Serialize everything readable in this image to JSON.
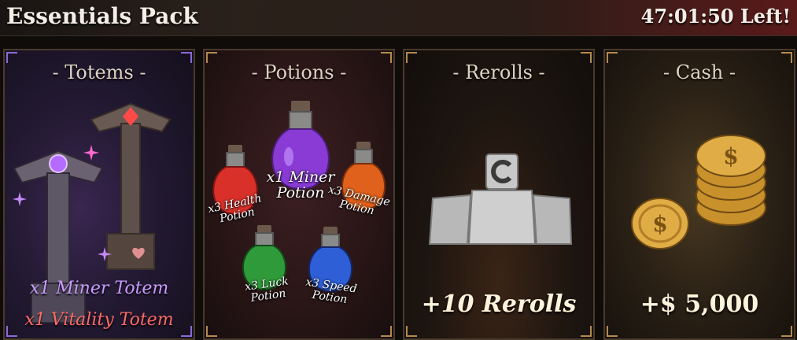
{
  "header": {
    "title": "Essentials Pack",
    "timer": "47:01:50 Left!"
  },
  "panels": {
    "totems": {
      "title": "- Totems -",
      "reward_1": "x1 Miner Totem",
      "reward_2": "x1 Vitality Totem"
    },
    "potions": {
      "title": "- Potions -",
      "items": [
        {
          "qty": "x3 Health",
          "name": "Potion",
          "color": "#d9302a"
        },
        {
          "qty": "x1 Miner",
          "name": "Potion",
          "color": "#8a3bd6"
        },
        {
          "qty": "x3 Damage",
          "name": "Potion",
          "color": "#e0611b"
        },
        {
          "qty": "x3 Luck",
          "name": "Potion",
          "color": "#2f9a3a"
        },
        {
          "qty": "x3 Speed",
          "name": "Potion",
          "color": "#2f5fd6"
        }
      ]
    },
    "rerolls": {
      "title": "- Rerolls -",
      "reward": "+10 Rerolls"
    },
    "cash": {
      "title": "- Cash -",
      "reward": "+$ 5,000"
    }
  },
  "colors": {
    "accent_purple": "#c99bff",
    "accent_red": "#ff6a6a",
    "gold": "#d6a23c"
  }
}
